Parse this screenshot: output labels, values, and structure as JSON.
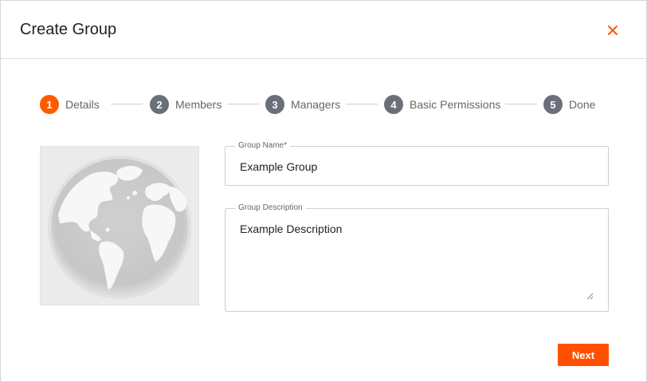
{
  "dialog": {
    "title": "Create Group",
    "close_icon": "close-icon"
  },
  "stepper": {
    "steps": [
      {
        "number": "1",
        "label": "Details",
        "state": "active"
      },
      {
        "number": "2",
        "label": "Members",
        "state": "inactive"
      },
      {
        "number": "3",
        "label": "Managers",
        "state": "inactive"
      },
      {
        "number": "4",
        "label": "Basic Permissions",
        "state": "inactive"
      },
      {
        "number": "5",
        "label": "Done",
        "state": "inactive"
      }
    ]
  },
  "image": {
    "icon": "globe-icon"
  },
  "form": {
    "group_name": {
      "label": "Group Name*",
      "value": "Example Group"
    },
    "group_description": {
      "label": "Group Description",
      "value": "Example Description"
    }
  },
  "actions": {
    "next_label": "Next"
  },
  "colors": {
    "accent": "#ff5000",
    "step_inactive": "#6b6f7a",
    "border": "#cfcfcf"
  }
}
